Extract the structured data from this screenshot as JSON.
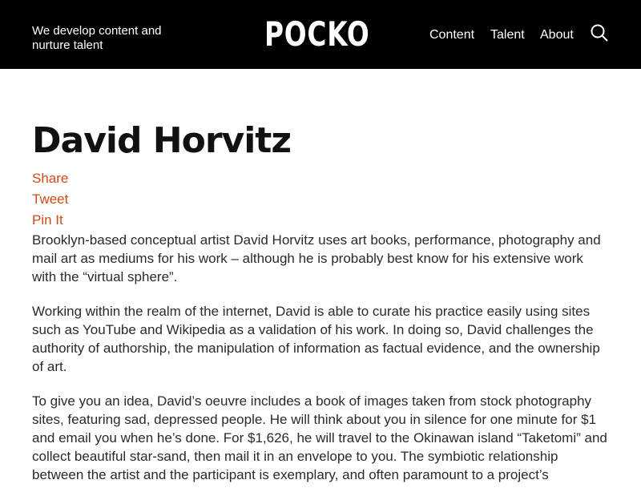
{
  "header": {
    "tagline": "We develop content and\nnurture talent",
    "logo": "POCKO",
    "nav": [
      {
        "label": "Content"
      },
      {
        "label": "Talent"
      },
      {
        "label": "About"
      }
    ],
    "search_icon": "search-icon"
  },
  "article": {
    "title": "David Horvitz",
    "share_links": [
      {
        "label": "Share"
      },
      {
        "label": "Tweet"
      },
      {
        "label": "Pin It"
      }
    ],
    "paragraphs": [
      "Brooklyn-based conceptual artist David Horvitz uses art books, performance, photography and mail art as mediums for his work – although he is probably best know for his extensive work with the “virtual sphere”.",
      "Working within the realm of the internet, David is able to curate his practice easily using sites such as YouTube and Wikipedia as a validation of his work. In doing so, David challenges the authority of authorship, the manipulation of information as factual evidence, and the ownership of art.",
      "To give you an idea, David’s oeuvre includes a book of images taken from stock photography sites, featuring sad, depressed people. He will think about you in silence for one minute for $1 and email you when he’s done. For $1,626, he will travel to the Okinawan island “Taketomi” and collect beautiful star-sand, then mail it in an envelope to you. The symbiotic relationship between the artist and the participant is exemplary, and often paramount to a project’s"
    ]
  },
  "colors": {
    "header_bg": "#000000",
    "accent": "#cf4a14",
    "text": "#2a2a2a"
  }
}
